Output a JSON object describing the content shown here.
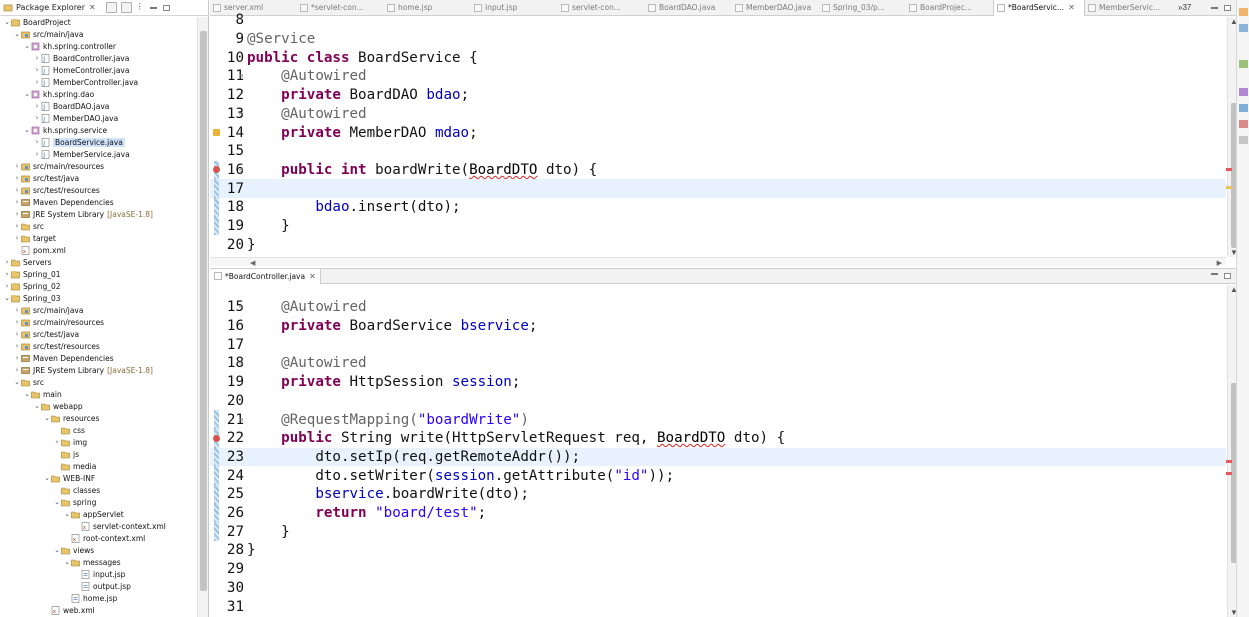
{
  "package_explorer": {
    "title": "Package Explorer",
    "tree": [
      {
        "depth": 0,
        "tw": "v",
        "icon": "project-icon",
        "label": "BoardProject"
      },
      {
        "depth": 1,
        "tw": "v",
        "icon": "source-folder-icon",
        "label": "src/main/java"
      },
      {
        "depth": 2,
        "tw": "v",
        "icon": "package-icon",
        "label": "kh.spring.controller"
      },
      {
        "depth": 3,
        "tw": ">",
        "icon": "java-file-icon",
        "label": "BoardController.java"
      },
      {
        "depth": 3,
        "tw": ">",
        "icon": "java-file-icon",
        "label": "HomeController.java"
      },
      {
        "depth": 3,
        "tw": ">",
        "icon": "java-file-icon",
        "label": "MemberController.java"
      },
      {
        "depth": 2,
        "tw": "v",
        "icon": "package-icon",
        "label": "kh.spring.dao"
      },
      {
        "depth": 3,
        "tw": ">",
        "icon": "java-file-icon",
        "label": "BoardDAO.java"
      },
      {
        "depth": 3,
        "tw": ">",
        "icon": "java-file-icon",
        "label": "MemberDAO.java"
      },
      {
        "depth": 2,
        "tw": "v",
        "icon": "package-icon",
        "label": "kh.spring.service"
      },
      {
        "depth": 3,
        "tw": ">",
        "icon": "java-file-icon",
        "label": "BoardService.java",
        "selected": true
      },
      {
        "depth": 3,
        "tw": ">",
        "icon": "java-file-icon",
        "label": "MemberService.java"
      },
      {
        "depth": 1,
        "tw": ">",
        "icon": "source-folder-icon",
        "label": "src/main/resources"
      },
      {
        "depth": 1,
        "tw": ">",
        "icon": "source-folder-icon",
        "label": "src/test/java"
      },
      {
        "depth": 1,
        "tw": ">",
        "icon": "source-folder-icon",
        "label": "src/test/resources"
      },
      {
        "depth": 1,
        "tw": ">",
        "icon": "library-icon",
        "label": "Maven Dependencies"
      },
      {
        "depth": 1,
        "tw": ">",
        "icon": "library-icon",
        "label": "JRE System Library",
        "decoration": "[JavaSE-1.8]"
      },
      {
        "depth": 1,
        "tw": ">",
        "icon": "folder-icon",
        "label": "src"
      },
      {
        "depth": 1,
        "tw": ">",
        "icon": "folder-icon",
        "label": "target"
      },
      {
        "depth": 1,
        "tw": "",
        "icon": "xml-file-icon",
        "label": "pom.xml"
      },
      {
        "depth": 0,
        "tw": ">",
        "icon": "folder-icon",
        "label": "Servers"
      },
      {
        "depth": 0,
        "tw": ">",
        "icon": "project-icon",
        "label": "Spring_01"
      },
      {
        "depth": 0,
        "tw": ">",
        "icon": "project-icon",
        "label": "Spring_02"
      },
      {
        "depth": 0,
        "tw": "v",
        "icon": "project-icon",
        "label": "Spring_03"
      },
      {
        "depth": 1,
        "tw": ">",
        "icon": "source-folder-icon",
        "label": "src/main/java"
      },
      {
        "depth": 1,
        "tw": ">",
        "icon": "source-folder-icon",
        "label": "src/main/resources"
      },
      {
        "depth": 1,
        "tw": ">",
        "icon": "source-folder-icon",
        "label": "src/test/java"
      },
      {
        "depth": 1,
        "tw": ">",
        "icon": "source-folder-icon",
        "label": "src/test/resources"
      },
      {
        "depth": 1,
        "tw": ">",
        "icon": "library-icon",
        "label": "Maven Dependencies"
      },
      {
        "depth": 1,
        "tw": ">",
        "icon": "library-icon",
        "label": "JRE System Library",
        "decoration": "[JavaSE-1.8]"
      },
      {
        "depth": 1,
        "tw": "v",
        "icon": "folder-icon",
        "label": "src"
      },
      {
        "depth": 2,
        "tw": "v",
        "icon": "folder-icon",
        "label": "main"
      },
      {
        "depth": 3,
        "tw": "v",
        "icon": "folder-icon",
        "label": "webapp"
      },
      {
        "depth": 4,
        "tw": "v",
        "icon": "folder-icon",
        "label": "resources"
      },
      {
        "depth": 5,
        "tw": "",
        "icon": "folder-icon",
        "label": "css"
      },
      {
        "depth": 5,
        "tw": ">",
        "icon": "folder-icon",
        "label": "img"
      },
      {
        "depth": 5,
        "tw": "",
        "icon": "folder-icon",
        "label": "js"
      },
      {
        "depth": 5,
        "tw": "",
        "icon": "folder-icon",
        "label": "media"
      },
      {
        "depth": 4,
        "tw": "v",
        "icon": "folder-icon",
        "label": "WEB-INF"
      },
      {
        "depth": 5,
        "tw": "",
        "icon": "folder-icon",
        "label": "classes"
      },
      {
        "depth": 5,
        "tw": "v",
        "icon": "folder-icon",
        "label": "spring"
      },
      {
        "depth": 6,
        "tw": "v",
        "icon": "folder-icon",
        "label": "appServlet"
      },
      {
        "depth": 7,
        "tw": "",
        "icon": "xml-file-icon",
        "label": "servlet-context.xml"
      },
      {
        "depth": 6,
        "tw": "",
        "icon": "xml-file-icon",
        "label": "root-context.xml"
      },
      {
        "depth": 5,
        "tw": "v",
        "icon": "folder-icon",
        "label": "views"
      },
      {
        "depth": 6,
        "tw": "v",
        "icon": "folder-icon",
        "label": "messages"
      },
      {
        "depth": 7,
        "tw": "",
        "icon": "jsp-file-icon",
        "label": "input.jsp"
      },
      {
        "depth": 7,
        "tw": "",
        "icon": "jsp-file-icon",
        "label": "output.jsp"
      },
      {
        "depth": 6,
        "tw": "",
        "icon": "jsp-file-icon",
        "label": "home.jsp"
      },
      {
        "depth": 4,
        "tw": "",
        "icon": "xml-file-icon",
        "label": "web.xml"
      }
    ]
  },
  "editor_tabs": [
    {
      "label": "server.xml",
      "active": false
    },
    {
      "label": "*servlet-con...",
      "active": false
    },
    {
      "label": "home.jsp",
      "active": false
    },
    {
      "label": "input.jsp",
      "active": false
    },
    {
      "label": "servlet-con...",
      "active": false
    },
    {
      "label": "BoardDAO.java",
      "active": false
    },
    {
      "label": "MemberDAO.java",
      "active": false
    },
    {
      "label": "Spring_03/p...",
      "active": false
    },
    {
      "label": "BoardProjec...",
      "active": false
    },
    {
      "label": "*BoardServic...",
      "active": true
    },
    {
      "label": "MemberServic...",
      "active": false
    }
  ],
  "editor_tabs_more": "»37",
  "editor_top": {
    "file": "BoardService.java",
    "lines": [
      {
        "n": "8",
        "tokens": []
      },
      {
        "n": "9",
        "tokens": [
          {
            "t": "an",
            "v": "@Service"
          }
        ]
      },
      {
        "n": "10",
        "tokens": [
          {
            "t": "kw",
            "v": "public"
          },
          {
            "t": "tp",
            "v": " "
          },
          {
            "t": "kw",
            "v": "class"
          },
          {
            "t": "tp",
            "v": " BoardService {"
          }
        ]
      },
      {
        "n": "11",
        "fold": true,
        "tokens": [
          {
            "t": "tp",
            "v": "    "
          },
          {
            "t": "an",
            "v": "@Autowired"
          }
        ]
      },
      {
        "n": "12",
        "tokens": [
          {
            "t": "tp",
            "v": "    "
          },
          {
            "t": "kw",
            "v": "private"
          },
          {
            "t": "tp",
            "v": " BoardDAO "
          },
          {
            "t": "fld",
            "v": "bdao"
          },
          {
            "t": "tp",
            "v": ";"
          }
        ]
      },
      {
        "n": "13",
        "fold": true,
        "tokens": [
          {
            "t": "tp",
            "v": "    "
          },
          {
            "t": "an",
            "v": "@Autowired"
          }
        ]
      },
      {
        "n": "14",
        "marker": "warn",
        "tokens": [
          {
            "t": "tp",
            "v": "    "
          },
          {
            "t": "kw",
            "v": "private"
          },
          {
            "t": "tp",
            "v": " MemberDAO "
          },
          {
            "t": "fld",
            "v": "mdao"
          },
          {
            "t": "tp",
            "v": ";"
          }
        ]
      },
      {
        "n": "15",
        "tokens": []
      },
      {
        "n": "16",
        "fold": true,
        "marker": "err",
        "chg": true,
        "tokens": [
          {
            "t": "tp",
            "v": "    "
          },
          {
            "t": "kw",
            "v": "public"
          },
          {
            "t": "tp",
            "v": " "
          },
          {
            "t": "kw",
            "v": "int"
          },
          {
            "t": "tp",
            "v": " boardWrite("
          },
          {
            "t": "wavy",
            "v": "BoardDTO"
          },
          {
            "t": "tp",
            "v": " dto) {"
          }
        ]
      },
      {
        "n": "17",
        "current": true,
        "chg": true,
        "tokens": []
      },
      {
        "n": "18",
        "chg": true,
        "tokens": [
          {
            "t": "tp",
            "v": "        "
          },
          {
            "t": "fld",
            "v": "bdao"
          },
          {
            "t": "tp",
            "v": ".insert(dto);"
          }
        ]
      },
      {
        "n": "19",
        "chg": true,
        "tokens": [
          {
            "t": "tp",
            "v": "    }"
          }
        ]
      },
      {
        "n": "20",
        "tokens": [
          {
            "t": "tp",
            "v": "}"
          }
        ]
      }
    ]
  },
  "editor_bottom": {
    "file": "*BoardController.java",
    "lines": [
      {
        "n": "15",
        "fold": true,
        "tokens": [
          {
            "t": "tp",
            "v": "    "
          },
          {
            "t": "an",
            "v": "@Autowired"
          }
        ]
      },
      {
        "n": "16",
        "tokens": [
          {
            "t": "tp",
            "v": "    "
          },
          {
            "t": "kw",
            "v": "private"
          },
          {
            "t": "tp",
            "v": " BoardService "
          },
          {
            "t": "fld",
            "v": "bservice"
          },
          {
            "t": "tp",
            "v": ";"
          }
        ]
      },
      {
        "n": "17",
        "tokens": []
      },
      {
        "n": "18",
        "fold": true,
        "tokens": [
          {
            "t": "tp",
            "v": "    "
          },
          {
            "t": "an",
            "v": "@Autowired"
          }
        ]
      },
      {
        "n": "19",
        "tokens": [
          {
            "t": "tp",
            "v": "    "
          },
          {
            "t": "kw",
            "v": "private"
          },
          {
            "t": "tp",
            "v": " HttpSession "
          },
          {
            "t": "fld",
            "v": "session"
          },
          {
            "t": "tp",
            "v": ";"
          }
        ]
      },
      {
        "n": "20",
        "tokens": []
      },
      {
        "n": "21",
        "fold": true,
        "chg": true,
        "tokens": [
          {
            "t": "tp",
            "v": "    "
          },
          {
            "t": "an",
            "v": "@RequestMapping("
          },
          {
            "t": "str",
            "v": "\"boardWrite\""
          },
          {
            "t": "an",
            "v": ")"
          }
        ]
      },
      {
        "n": "22",
        "marker": "err",
        "chg": true,
        "tokens": [
          {
            "t": "tp",
            "v": "    "
          },
          {
            "t": "kw",
            "v": "public"
          },
          {
            "t": "tp",
            "v": " String write(HttpServletRequest req, "
          },
          {
            "t": "wavy",
            "v": "BoardDTO"
          },
          {
            "t": "tp",
            "v": " dto) {"
          }
        ]
      },
      {
        "n": "23",
        "current": true,
        "chg": true,
        "tokens": [
          {
            "t": "tp",
            "v": "        dto.setIp(req.getRemoteAddr());"
          }
        ]
      },
      {
        "n": "24",
        "chg": true,
        "tokens": [
          {
            "t": "tp",
            "v": "        dto.setWriter("
          },
          {
            "t": "fld",
            "v": "session"
          },
          {
            "t": "tp",
            "v": ".getAttribute("
          },
          {
            "t": "str",
            "v": "\"id\""
          },
          {
            "t": "tp",
            "v": "));"
          }
        ]
      },
      {
        "n": "25",
        "chg": true,
        "tokens": [
          {
            "t": "tp",
            "v": "        "
          },
          {
            "t": "fld",
            "v": "bservice"
          },
          {
            "t": "tp",
            "v": ".boardWrite(dto);"
          }
        ]
      },
      {
        "n": "26",
        "chg": true,
        "tokens": [
          {
            "t": "tp",
            "v": "        "
          },
          {
            "t": "kw",
            "v": "return"
          },
          {
            "t": "tp",
            "v": " "
          },
          {
            "t": "str",
            "v": "\"board/test\""
          },
          {
            "t": "tp",
            "v": ";"
          }
        ]
      },
      {
        "n": "27",
        "chg": true,
        "tokens": [
          {
            "t": "tp",
            "v": "    }"
          }
        ]
      },
      {
        "n": "28",
        "tokens": [
          {
            "t": "tp",
            "v": "}"
          }
        ]
      },
      {
        "n": "29",
        "tokens": []
      },
      {
        "n": "30",
        "tokens": []
      },
      {
        "n": "31",
        "tokens": []
      }
    ]
  },
  "colors": {
    "keyword": "#7f0055",
    "annotation": "#646464",
    "field": "#0000c0",
    "string": "#2a00ff",
    "current_line": "#e8f2fe",
    "selection": "#cfe3fb"
  }
}
